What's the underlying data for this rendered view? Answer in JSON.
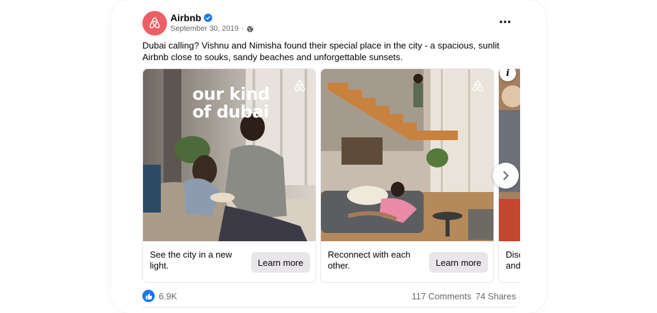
{
  "post": {
    "author": "Airbnb",
    "date": "September 30, 2019",
    "date_sep": "·",
    "text": "Dubai calling? Vishnu and Nimisha found their special place in the city - a spacious, sunlit Airbnb close to souks, sandy beaches and unforgettable sunsets.",
    "brand_color": "#ee5e65",
    "verified_color": "#1877f2"
  },
  "carousel": {
    "slides": [
      {
        "overlay_line1": "our kind",
        "overlay_line2": "of dubai",
        "caption": "See the city in a new light.",
        "button": "Learn more"
      },
      {
        "caption": "Reconnect with each other.",
        "button": "Learn more"
      },
      {
        "caption_line1": "Disc",
        "caption_line2": "and"
      }
    ],
    "info_label": "i"
  },
  "footer": {
    "likes": "6.9K",
    "comments": "117 Comments",
    "shares": "74 Shares"
  }
}
